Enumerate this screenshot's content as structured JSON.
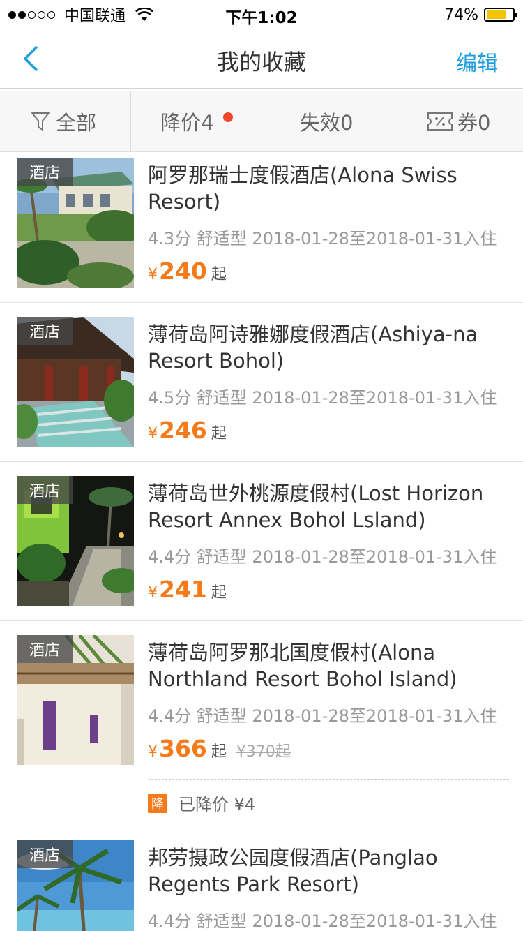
{
  "status_bar": {
    "carrier": "中国联通",
    "time": "下午1:02",
    "battery": "74%",
    "battery_level": 0.74,
    "signal_full": 2,
    "signal_empty": 3
  },
  "nav": {
    "title": "我的收藏",
    "edit_label": "编辑",
    "back_icon": "chevron-left-icon",
    "accent_color": "#1f9ee0"
  },
  "filters": {
    "all_label": "全部",
    "drop_label": "降价4",
    "invalid_label": "失效0",
    "coupon_label": "券0"
  },
  "colors": {
    "price": "#f57b1a",
    "badge_dot": "#f0462d"
  },
  "items": [
    {
      "tag": "酒店",
      "name": "阿罗那瑞士度假酒店(Alona Swiss Resort)",
      "meta": "4.3分 舒适型 2018-01-28至2018-01-31入住",
      "currency": "¥",
      "price": "240",
      "suffix": "起"
    },
    {
      "tag": "酒店",
      "name": "薄荷岛阿诗雅娜度假酒店(Ashiya-na Resort Bohol)",
      "meta": "4.5分 舒适型 2018-01-28至2018-01-31入住",
      "currency": "¥",
      "price": "246",
      "suffix": "起"
    },
    {
      "tag": "酒店",
      "name": "薄荷岛世外桃源度假村(Lost Horizon Resort Annex Bohol Lsland)",
      "meta": "4.4分 舒适型 2018-01-28至2018-01-31入住",
      "currency": "¥",
      "price": "241",
      "suffix": "起"
    },
    {
      "tag": "酒店",
      "name": "薄荷岛阿罗那北国度假村(Alona Northland Resort Bohol Island)",
      "meta": "4.4分 舒适型 2018-01-28至2018-01-31入住",
      "currency": "¥",
      "price": "366",
      "suffix": "起",
      "original": "¥370起",
      "drop_badge": "降",
      "drop_text": "已降价 ¥4"
    },
    {
      "tag": "酒店",
      "name": "邦劳摄政公园度假酒店(Panglao Regents Park Resort)",
      "meta": "4.4分 舒适型 2018-01-28至2018-01-31入住"
    }
  ]
}
